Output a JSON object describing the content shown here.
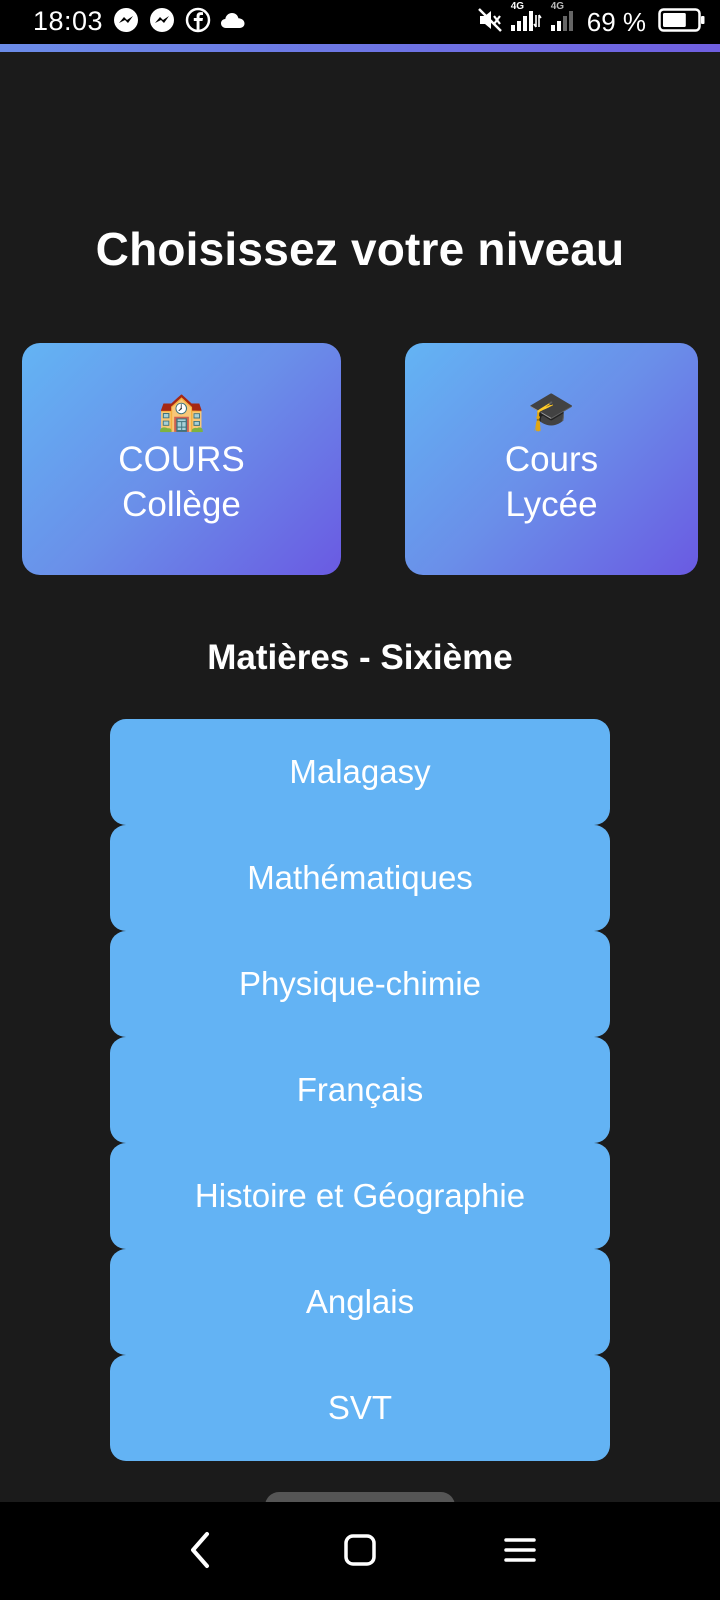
{
  "status_bar": {
    "time": "18:03",
    "battery": "69 %",
    "network_label_1": "4G",
    "network_label_2": "4G",
    "notification_icons": [
      "messenger-icon",
      "messenger-icon",
      "facebook-icon",
      "cloud-icon"
    ],
    "status_icons": [
      "mute-icon",
      "signal-icon",
      "signal-icon",
      "battery-icon"
    ],
    "battery_level": 0.69
  },
  "page": {
    "title": "Choisissez votre niveau"
  },
  "levels": [
    {
      "emoji": "🏫",
      "line1": "COURS",
      "line2": "Collège"
    },
    {
      "emoji": "🎓",
      "line1": "Cours",
      "line2": "Lycée"
    }
  ],
  "subjects": {
    "title": "Matières - Sixième",
    "items": [
      {
        "label": "Malagasy"
      },
      {
        "label": "Mathématiques"
      },
      {
        "label": "Physique-chimie"
      },
      {
        "label": "Français"
      },
      {
        "label": "Histoire et Géographie"
      },
      {
        "label": "Anglais"
      },
      {
        "label": "SVT"
      }
    ]
  },
  "nav_bar": {
    "icons": [
      "back-icon",
      "home-icon",
      "menu-icon"
    ]
  },
  "colors": {
    "background": "#1b1b1b",
    "subject_button": "#63b3f4",
    "card_gradient_start": "#63b4f4",
    "card_gradient_end": "#6a5ae2"
  }
}
